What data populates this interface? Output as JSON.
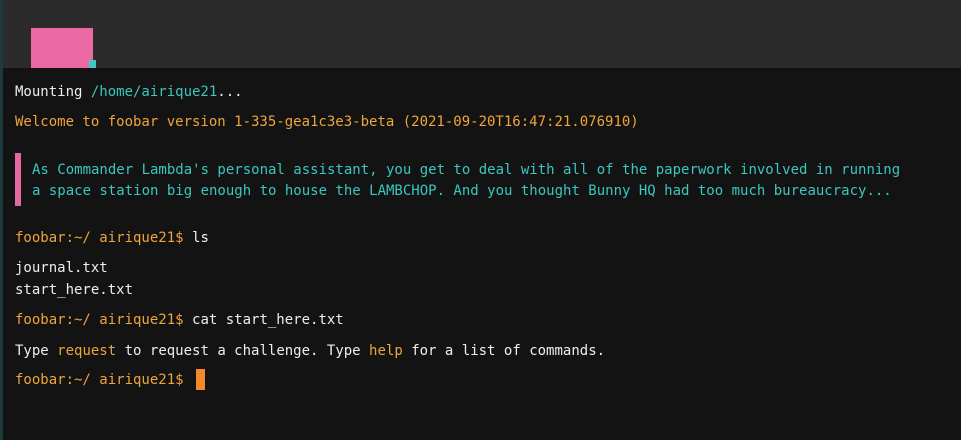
{
  "terminal": {
    "mount": {
      "prefix": "Mounting ",
      "path": "/home/airique21",
      "suffix": "..."
    },
    "welcome": "Welcome to foobar version 1-335-gea1c3e3-beta (2021-09-20T16:47:21.076910)",
    "intro_lines": [
      "As Commander Lambda's personal assistant, you get to deal with all of the paperwork involved in running",
      "a space station big enough to house the LAMBCHOP. And you thought Bunny HQ had too much bureaucracy..."
    ],
    "prompt": "foobar:~/ airique21$",
    "commands": [
      {
        "command": "ls",
        "output": [
          "journal.txt",
          "start_here.txt"
        ]
      },
      {
        "command": "cat start_here.txt"
      }
    ],
    "help_text": {
      "part1": "Type ",
      "request_kw": "request",
      "part2": " to request a challenge. Type ",
      "help_kw": "help",
      "part3": " for a list of commands."
    }
  },
  "colors": {
    "background": "#131313",
    "topbar": "#2b2b2b",
    "accent_pink": "#ec6aa4",
    "accent_teal": "#3ac7bf",
    "prompt_orange": "#f0a43a",
    "cursor_orange": "#f08a2c"
  }
}
